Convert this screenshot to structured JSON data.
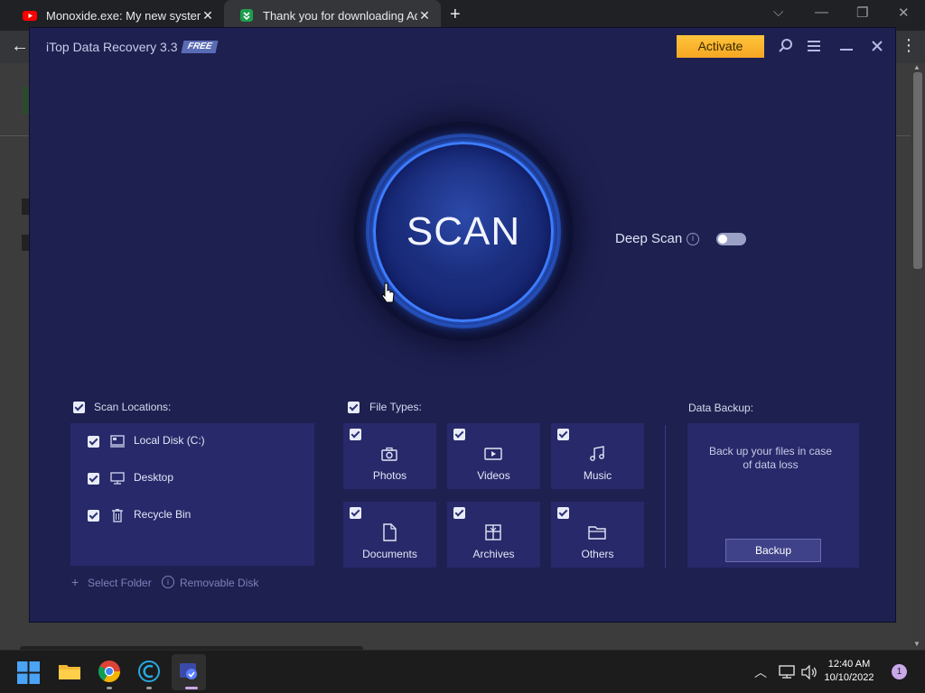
{
  "browser": {
    "tabs": [
      {
        "title": "Monoxide.exe: My new system d",
        "close": "✕"
      },
      {
        "title": "Thank you for downloading Adva",
        "close": "✕"
      }
    ],
    "new_tab": "+",
    "controls": {
      "dropdown": "⌵",
      "minimize": "—",
      "restore": "❐",
      "close": "✕"
    },
    "back": "←",
    "menu": "⋮"
  },
  "app": {
    "title": "iTop Data Recovery 3.3",
    "badge": "FREE",
    "activate_label": "Activate",
    "scan_label": "SCAN",
    "deep_scan_label": "Deep Scan",
    "deep_scan_enabled": false,
    "scan_locations": {
      "label": "Scan Locations:",
      "checked": true,
      "items": [
        {
          "label": "Local Disk (C:)",
          "icon": "drive-icon",
          "checked": true
        },
        {
          "label": "Desktop",
          "icon": "monitor-icon",
          "checked": true
        },
        {
          "label": "Recycle Bin",
          "icon": "trash-icon",
          "checked": true
        }
      ],
      "select_folder": "Select Folder",
      "removable_disk": "Removable Disk"
    },
    "file_types": {
      "label": "File Types:",
      "checked": true,
      "items": [
        {
          "label": "Photos",
          "icon": "camera-icon",
          "checked": true
        },
        {
          "label": "Videos",
          "icon": "video-icon",
          "checked": true
        },
        {
          "label": "Music",
          "icon": "music-icon",
          "checked": true
        },
        {
          "label": "Documents",
          "icon": "document-icon",
          "checked": true
        },
        {
          "label": "Archives",
          "icon": "archive-icon",
          "checked": true
        },
        {
          "label": "Others",
          "icon": "folder-icon",
          "checked": true
        }
      ]
    },
    "data_backup": {
      "label": "Data Backup:",
      "description": "Back up your files in case of data loss",
      "button": "Backup"
    }
  },
  "taskbar": {
    "time": "12:40 AM",
    "date": "10/10/2022",
    "notifications": "1"
  },
  "colors": {
    "app_bg": "#1e2050",
    "panel_bg": "#27296a",
    "accent_blue": "#3d7dff",
    "activate_orange": "#f5a623"
  }
}
